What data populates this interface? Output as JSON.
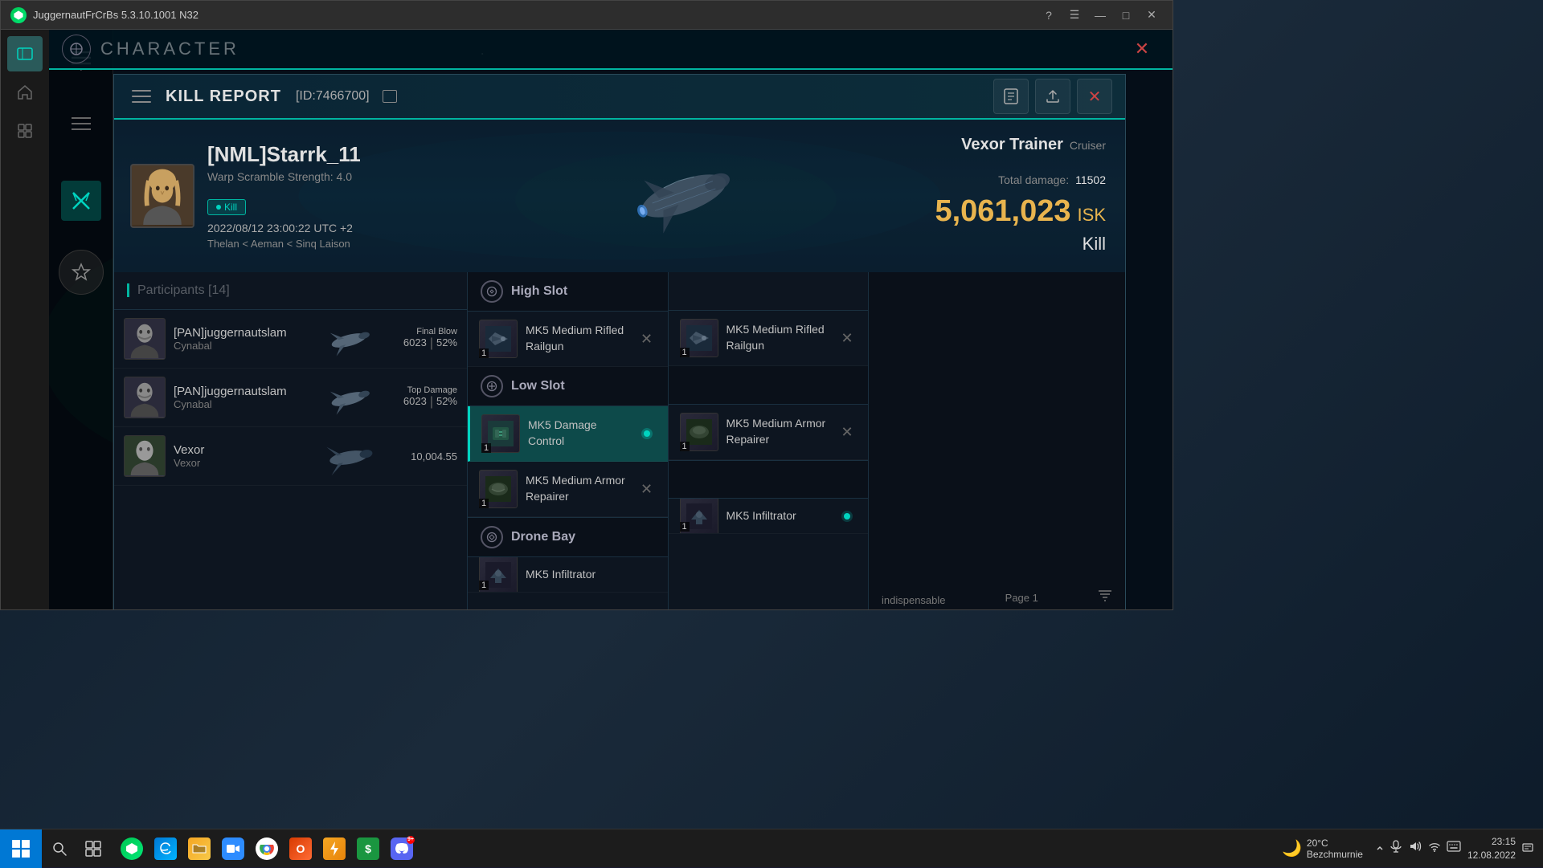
{
  "app": {
    "title": "JuggernautFrCrBs 5.3.10.1001 N32",
    "icon": "BS"
  },
  "window_controls": {
    "help": "?",
    "menu": "☰",
    "minimize": "—",
    "maximize": "□",
    "close": "✕"
  },
  "header": {
    "character_label": "CHARACTER"
  },
  "kill_report": {
    "title": "KILL REPORT",
    "id": "[ID:7466700]",
    "victim": {
      "name": "[NML]Starrk_11",
      "warp_scramble": "Warp Scramble Strength: 4.0",
      "kill_badge": "Kill",
      "datetime": "2022/08/12 23:00:22 UTC +2",
      "location": "Thelan < Aeman < Sinq Laison"
    },
    "ship": {
      "type": "Vexor Trainer",
      "class": "Cruiser",
      "total_damage_label": "Total damage:",
      "total_damage": "11502",
      "isk_value": "5,061,023",
      "isk_label": "ISK",
      "result": "Kill"
    },
    "participants": {
      "title": "Participants",
      "count": "[14]",
      "list": [
        {
          "name": "[PAN]juggernautslam",
          "corp": "Cynabal",
          "badge": "Final Blow",
          "damage": "6023",
          "pct": "52%"
        },
        {
          "name": "[PAN]juggernautslam",
          "corp": "Cynabal",
          "badge": "Top Damage",
          "damage": "6023",
          "pct": "52%"
        },
        {
          "name": "Vexor",
          "corp": "Vexor",
          "badge": "",
          "damage": "10,004.55",
          "pct": ""
        }
      ]
    },
    "fittings": {
      "high_slot": {
        "label": "High Slot",
        "items": [
          {
            "name": "MK5 Medium Rifled Railgun",
            "count": "1",
            "highlighted": false
          },
          {
            "name": "MK5 Medium Rifled Railgun",
            "count": "1",
            "highlighted": false
          }
        ]
      },
      "low_slot": {
        "label": "Low Slot",
        "items": [
          {
            "name": "MK5 Damage Control",
            "count": "1",
            "highlighted": true
          },
          {
            "name": "MK5 Medium Armor Repairer",
            "count": "1",
            "highlighted": false
          }
        ]
      },
      "low_slot_right": {
        "items": [
          {
            "name": "MK5 Medium Armor Repairer",
            "count": "1",
            "highlighted": false
          }
        ]
      },
      "drone_bay": {
        "label": "Drone Bay",
        "items": [
          {
            "name": "MK5 Infiltrator",
            "count": "1",
            "highlighted": false
          },
          {
            "name": "MK5 Infiltrator",
            "count": "1",
            "highlighted": false
          }
        ]
      }
    },
    "extra": {
      "indispensable": "indispensable",
      "page": "Page 1"
    }
  },
  "taskbar": {
    "weather": "20°C",
    "location": "Bezchmurnie",
    "time": "23:15",
    "date": "12.08.2022"
  }
}
